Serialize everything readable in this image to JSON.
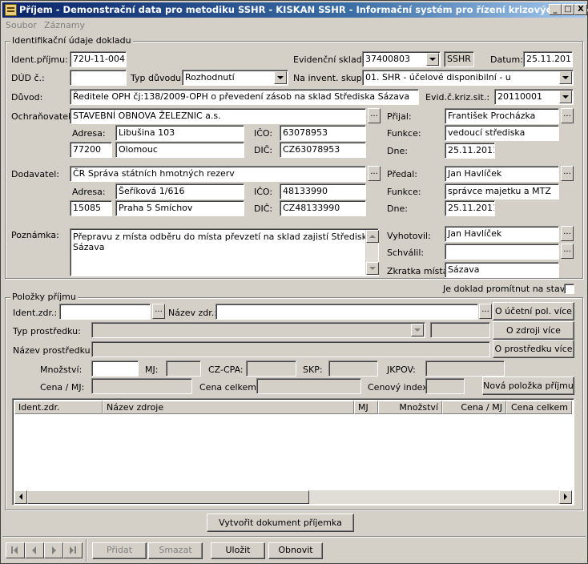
{
  "window": {
    "title": "Příjem - Demonstrační data pro metodiku SSHR - KISKAN SSHR - Informační systém pro řízení krizových situací",
    "min_label": "_",
    "max_label": "□",
    "close_label": "X"
  },
  "menu": {
    "file": "Soubor",
    "records": "Záznamy"
  },
  "doc": {
    "group_title": "Identifikační údaje dokladu",
    "ident_label": "Ident.příjmu:",
    "ident_value": "72U-11-004",
    "sklad_label": "Evidenční sklad:",
    "sklad_value": "37400803",
    "sklad_tag": "SSHR",
    "datum_label": "Datum:",
    "datum_value": "25.11.2011",
    "dud_label": "DÚD č.:",
    "dud_value": "",
    "typ_label": "Typ důvodu:",
    "typ_value": "Rozhodnutí",
    "invent_label": "Na invent. skup.:",
    "invent_value": "01. SHR - účelové disponibilní - u",
    "duvod_label": "Důvod:",
    "duvod_value": "Ředitele OPH čj:138/2009-OPH o převedení zásob na sklad Střediska Sázava",
    "evid_label": "Evid.č.kriz.sit.:",
    "evid_value": "20110001",
    "ochr_label": "Ochraňovatel:",
    "ochr_value": "STAVEBNÍ OBNOVA ŽELEZNIC a.s.",
    "ochr_adresa_label": "Adresa:",
    "ochr_street": "Libušina 103",
    "ochr_psc": "77200",
    "ochr_city": "Olomouc",
    "ochr_ico_label": "IČO:",
    "ochr_ico": "63078953",
    "ochr_dic_label": "DIČ:",
    "ochr_dic": "CZ63078953",
    "prijal_label": "Přijal:",
    "prijal_value": "František Procházka",
    "prijal_funkce_label": "Funkce:",
    "prijal_funkce": "vedoucí střediska",
    "prijal_dne_label": "Dne:",
    "prijal_dne": "25.11.2011",
    "dod_label": "Dodavatel:",
    "dod_value": "ČR Správa státních hmotných rezerv",
    "dod_adresa_label": "Adresa:",
    "dod_street": "Šeříková 1/616",
    "dod_psc": "15085",
    "dod_city": "Praha 5 Smíchov",
    "dod_ico_label": "IČO:",
    "dod_ico": "48133990",
    "dod_dic_label": "DIČ:",
    "dod_dic": "CZ48133990",
    "predal_label": "Předal:",
    "predal_value": "Jan Havlíček",
    "predal_funkce_label": "Funkce:",
    "predal_funkce": "správce majetku a MTZ",
    "predal_dne_label": "Dne:",
    "predal_dne": "25.11.2011",
    "pozn_label": "Poznámka:",
    "pozn_value": "Přepravu z místa odběru do místa převzetí na sklad zajistí Středisko Sázava",
    "vyhot_label": "Vyhotovil:",
    "vyhot_value": "Jan Havlíček",
    "schvalil_label": "Schválil:",
    "schvalil_value": "",
    "zkratka_label": "Zkratka místa:",
    "zkratka_value": "Sázava",
    "promitnout_label": "Je doklad promítnut na stav ?"
  },
  "items": {
    "group_title": "Položky příjmu",
    "identzdr_label": "Ident.zdr.:",
    "nazevzdr_label": "Název zdr.:",
    "btn_ucetni": "O účetní pol. více",
    "btn_zdroji": "O zdroji více",
    "btn_prostredku": "O prostředku více",
    "typ_label": "Typ prostředku:",
    "nazev_label": "Název prostředku:",
    "mnozstvi_label": "Množství:",
    "mj_label": "MJ:",
    "czcpa_label": "CZ-CPA:",
    "skp_label": "SKP:",
    "jkpov_label": "JKPOV:",
    "cena_mj_label": "Cena / MJ:",
    "cena_celkem_label": "Cena celkem:",
    "cenovy_label": "Cenový index:",
    "btn_nova": "Nová položka příjmu"
  },
  "grid": {
    "columns": [
      "Ident.zdr.",
      "Název zdroje",
      "MJ",
      "Množství",
      "Cena / MJ",
      "Cena celkem"
    ]
  },
  "actions": {
    "create_doc": "Vytvořit dokument příjemka",
    "pridat": "Přidat",
    "smazat": "Smazat",
    "ulozit": "Uložit",
    "obnovit": "Obnovit"
  }
}
